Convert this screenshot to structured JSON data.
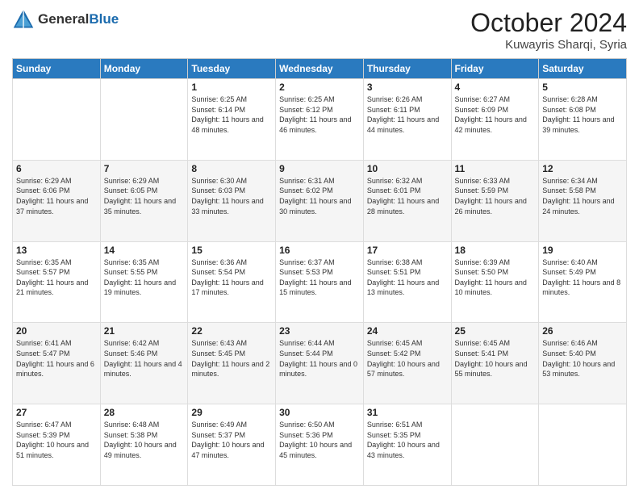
{
  "header": {
    "logo_general": "General",
    "logo_blue": "Blue",
    "month_title": "October 2024",
    "location": "Kuwayris Sharqi, Syria"
  },
  "days_of_week": [
    "Sunday",
    "Monday",
    "Tuesday",
    "Wednesday",
    "Thursday",
    "Friday",
    "Saturday"
  ],
  "weeks": [
    [
      null,
      null,
      {
        "day": 1,
        "sunrise": "Sunrise: 6:25 AM",
        "sunset": "Sunset: 6:14 PM",
        "daylight": "Daylight: 11 hours and 48 minutes."
      },
      {
        "day": 2,
        "sunrise": "Sunrise: 6:25 AM",
        "sunset": "Sunset: 6:12 PM",
        "daylight": "Daylight: 11 hours and 46 minutes."
      },
      {
        "day": 3,
        "sunrise": "Sunrise: 6:26 AM",
        "sunset": "Sunset: 6:11 PM",
        "daylight": "Daylight: 11 hours and 44 minutes."
      },
      {
        "day": 4,
        "sunrise": "Sunrise: 6:27 AM",
        "sunset": "Sunset: 6:09 PM",
        "daylight": "Daylight: 11 hours and 42 minutes."
      },
      {
        "day": 5,
        "sunrise": "Sunrise: 6:28 AM",
        "sunset": "Sunset: 6:08 PM",
        "daylight": "Daylight: 11 hours and 39 minutes."
      }
    ],
    [
      {
        "day": 6,
        "sunrise": "Sunrise: 6:29 AM",
        "sunset": "Sunset: 6:06 PM",
        "daylight": "Daylight: 11 hours and 37 minutes."
      },
      {
        "day": 7,
        "sunrise": "Sunrise: 6:29 AM",
        "sunset": "Sunset: 6:05 PM",
        "daylight": "Daylight: 11 hours and 35 minutes."
      },
      {
        "day": 8,
        "sunrise": "Sunrise: 6:30 AM",
        "sunset": "Sunset: 6:03 PM",
        "daylight": "Daylight: 11 hours and 33 minutes."
      },
      {
        "day": 9,
        "sunrise": "Sunrise: 6:31 AM",
        "sunset": "Sunset: 6:02 PM",
        "daylight": "Daylight: 11 hours and 30 minutes."
      },
      {
        "day": 10,
        "sunrise": "Sunrise: 6:32 AM",
        "sunset": "Sunset: 6:01 PM",
        "daylight": "Daylight: 11 hours and 28 minutes."
      },
      {
        "day": 11,
        "sunrise": "Sunrise: 6:33 AM",
        "sunset": "Sunset: 5:59 PM",
        "daylight": "Daylight: 11 hours and 26 minutes."
      },
      {
        "day": 12,
        "sunrise": "Sunrise: 6:34 AM",
        "sunset": "Sunset: 5:58 PM",
        "daylight": "Daylight: 11 hours and 24 minutes."
      }
    ],
    [
      {
        "day": 13,
        "sunrise": "Sunrise: 6:35 AM",
        "sunset": "Sunset: 5:57 PM",
        "daylight": "Daylight: 11 hours and 21 minutes."
      },
      {
        "day": 14,
        "sunrise": "Sunrise: 6:35 AM",
        "sunset": "Sunset: 5:55 PM",
        "daylight": "Daylight: 11 hours and 19 minutes."
      },
      {
        "day": 15,
        "sunrise": "Sunrise: 6:36 AM",
        "sunset": "Sunset: 5:54 PM",
        "daylight": "Daylight: 11 hours and 17 minutes."
      },
      {
        "day": 16,
        "sunrise": "Sunrise: 6:37 AM",
        "sunset": "Sunset: 5:53 PM",
        "daylight": "Daylight: 11 hours and 15 minutes."
      },
      {
        "day": 17,
        "sunrise": "Sunrise: 6:38 AM",
        "sunset": "Sunset: 5:51 PM",
        "daylight": "Daylight: 11 hours and 13 minutes."
      },
      {
        "day": 18,
        "sunrise": "Sunrise: 6:39 AM",
        "sunset": "Sunset: 5:50 PM",
        "daylight": "Daylight: 11 hours and 10 minutes."
      },
      {
        "day": 19,
        "sunrise": "Sunrise: 6:40 AM",
        "sunset": "Sunset: 5:49 PM",
        "daylight": "Daylight: 11 hours and 8 minutes."
      }
    ],
    [
      {
        "day": 20,
        "sunrise": "Sunrise: 6:41 AM",
        "sunset": "Sunset: 5:47 PM",
        "daylight": "Daylight: 11 hours and 6 minutes."
      },
      {
        "day": 21,
        "sunrise": "Sunrise: 6:42 AM",
        "sunset": "Sunset: 5:46 PM",
        "daylight": "Daylight: 11 hours and 4 minutes."
      },
      {
        "day": 22,
        "sunrise": "Sunrise: 6:43 AM",
        "sunset": "Sunset: 5:45 PM",
        "daylight": "Daylight: 11 hours and 2 minutes."
      },
      {
        "day": 23,
        "sunrise": "Sunrise: 6:44 AM",
        "sunset": "Sunset: 5:44 PM",
        "daylight": "Daylight: 11 hours and 0 minutes."
      },
      {
        "day": 24,
        "sunrise": "Sunrise: 6:45 AM",
        "sunset": "Sunset: 5:42 PM",
        "daylight": "Daylight: 10 hours and 57 minutes."
      },
      {
        "day": 25,
        "sunrise": "Sunrise: 6:45 AM",
        "sunset": "Sunset: 5:41 PM",
        "daylight": "Daylight: 10 hours and 55 minutes."
      },
      {
        "day": 26,
        "sunrise": "Sunrise: 6:46 AM",
        "sunset": "Sunset: 5:40 PM",
        "daylight": "Daylight: 10 hours and 53 minutes."
      }
    ],
    [
      {
        "day": 27,
        "sunrise": "Sunrise: 6:47 AM",
        "sunset": "Sunset: 5:39 PM",
        "daylight": "Daylight: 10 hours and 51 minutes."
      },
      {
        "day": 28,
        "sunrise": "Sunrise: 6:48 AM",
        "sunset": "Sunset: 5:38 PM",
        "daylight": "Daylight: 10 hours and 49 minutes."
      },
      {
        "day": 29,
        "sunrise": "Sunrise: 6:49 AM",
        "sunset": "Sunset: 5:37 PM",
        "daylight": "Daylight: 10 hours and 47 minutes."
      },
      {
        "day": 30,
        "sunrise": "Sunrise: 6:50 AM",
        "sunset": "Sunset: 5:36 PM",
        "daylight": "Daylight: 10 hours and 45 minutes."
      },
      {
        "day": 31,
        "sunrise": "Sunrise: 6:51 AM",
        "sunset": "Sunset: 5:35 PM",
        "daylight": "Daylight: 10 hours and 43 minutes."
      },
      null,
      null
    ]
  ]
}
